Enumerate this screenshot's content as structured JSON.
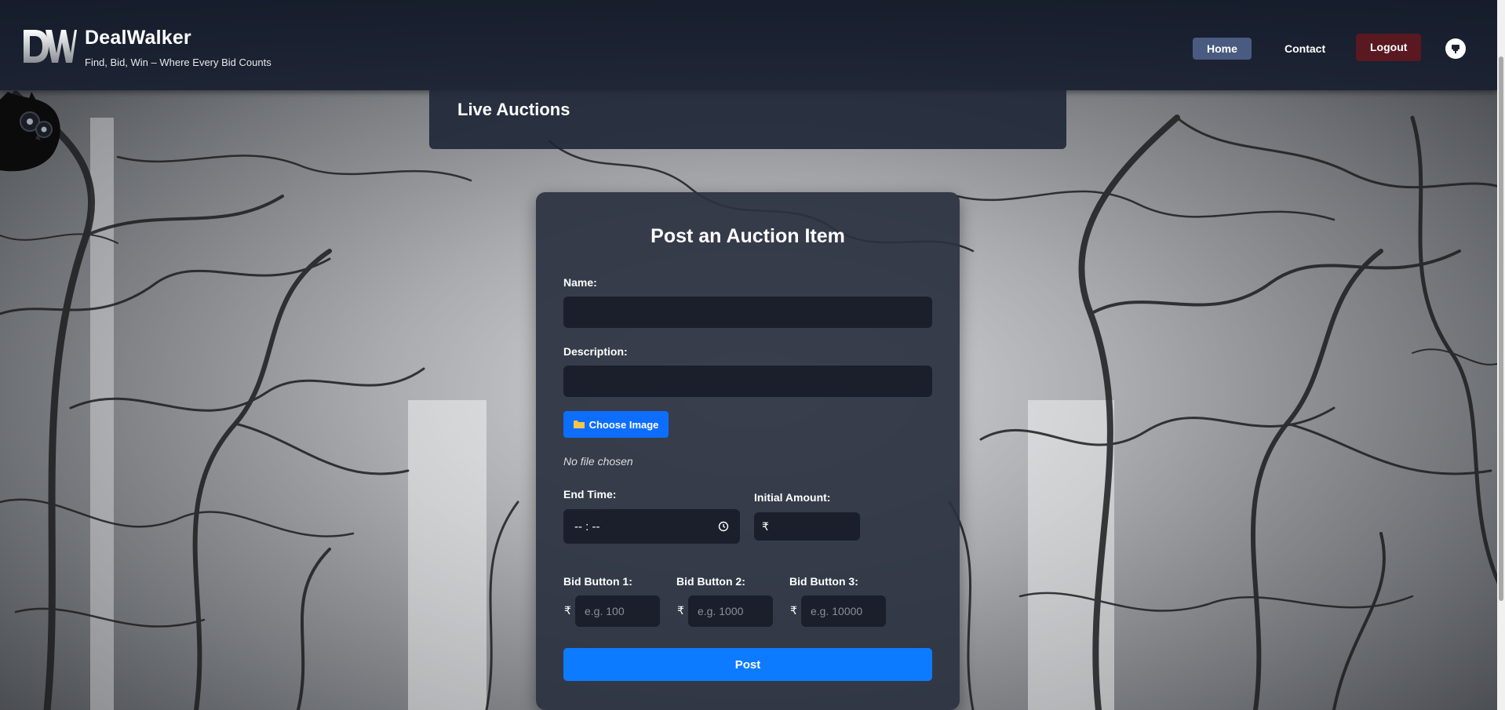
{
  "header": {
    "brand_name": "DealWalker",
    "tagline": "Find, Bid, Win – Where Every Bid Counts",
    "logo_letters": "DW",
    "nav": {
      "home": "Home",
      "contact": "Contact",
      "logout": "Logout"
    },
    "notification_icon": "bell-icon"
  },
  "live_auctions": {
    "title": "Live Auctions"
  },
  "form": {
    "title": "Post an Auction Item",
    "name_label": "Name:",
    "description_label": "Description:",
    "choose_image_label": "Choose Image",
    "no_file_text": "No file chosen",
    "end_time_label": "End Time:",
    "end_time_value": "-- : --",
    "initial_amount_label": "Initial Amount:",
    "currency_symbol": "₹",
    "bid_buttons": [
      {
        "label": "Bid Button 1:",
        "placeholder": "e.g. 100"
      },
      {
        "label": "Bid Button 2:",
        "placeholder": "e.g. 1000"
      },
      {
        "label": "Bid Button 3:",
        "placeholder": "e.g. 10000"
      }
    ],
    "post_label": "Post"
  },
  "colors": {
    "accent": "#0d6efd",
    "logout": "#5a1821",
    "home_active": "#4a5b82"
  }
}
